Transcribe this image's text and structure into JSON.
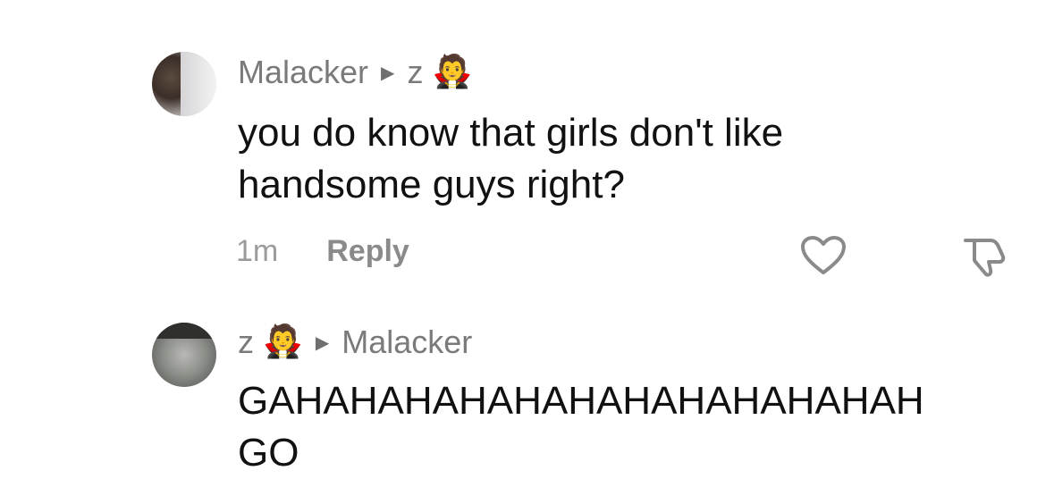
{
  "comments": [
    {
      "author": "Malacker",
      "reply_to": "z",
      "reply_to_emoji": "🧛",
      "text": "you do know that girls don't like\nhandsome guys right?",
      "time": "1m",
      "reply_label": "Reply"
    },
    {
      "author": "z",
      "author_emoji": "🧛",
      "reply_to": "Malacker",
      "text": "GAHAHAHAHAHAHAHAHAHAHAHAH GO"
    }
  ],
  "icons": {
    "arrow": "triangle-right-icon",
    "like": "heart-icon",
    "dislike": "thumbs-down-icon"
  },
  "colors": {
    "secondary_text": "#7a7a7a",
    "primary_text": "#111111",
    "icon_stroke": "#8a8a8a"
  }
}
